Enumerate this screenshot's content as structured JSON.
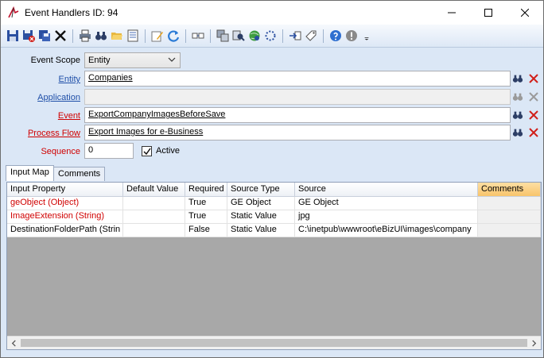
{
  "window": {
    "title": "Event Handlers ID: 94"
  },
  "toolbar": {
    "icons": [
      "save-icon",
      "save-close-icon",
      "save-all-icon",
      "delete-icon",
      "print-icon",
      "binoculars-icon",
      "open-folder-icon",
      "properties-icon",
      "edit-note-icon",
      "refresh-icon",
      "columns-icon",
      "copy-icon",
      "find-icon",
      "globe-icon",
      "settings-spin-icon",
      "import-icon",
      "tag-icon",
      "help-icon",
      "stop-info-icon",
      "overflow-icon"
    ]
  },
  "form": {
    "event_scope": {
      "label": "Event Scope",
      "value": "Entity"
    },
    "entity": {
      "label": "Entity",
      "value": "Companies"
    },
    "application": {
      "label": "Application",
      "value": ""
    },
    "event": {
      "label": "Event",
      "value": "ExportCompanyImagesBeforeSave"
    },
    "process_flow": {
      "label": "Process Flow",
      "value": "Export Images for e-Business"
    },
    "sequence": {
      "label": "Sequence",
      "value": "0"
    },
    "active": {
      "label": "Active",
      "checked": true
    }
  },
  "tabs": [
    {
      "label": "Input Map",
      "active": true
    },
    {
      "label": "Comments",
      "active": false
    }
  ],
  "grid": {
    "columns": [
      "Input Property",
      "Default Value",
      "Required",
      "Source Type",
      "Source",
      "Comments"
    ],
    "rows": [
      {
        "input_property": "geObject (Object)",
        "default_value": "",
        "required": "True",
        "source_type": "GE Object",
        "source": "GE Object",
        "comments": "",
        "required_flag": true
      },
      {
        "input_property": "ImageExtension (String)",
        "default_value": "",
        "required": "True",
        "source_type": "Static Value",
        "source": "jpg",
        "comments": "",
        "required_flag": true
      },
      {
        "input_property": "DestinationFolderPath (Strin",
        "default_value": "",
        "required": "False",
        "source_type": "Static Value",
        "source": "C:\\inetpub\\wwwroot\\eBizUI\\images\\company",
        "comments": "",
        "required_flag": false
      }
    ]
  },
  "colors": {
    "required_text": "#d00000",
    "link": "#1f4fa8",
    "window_bg": "#dbe7f6",
    "sorted_header": "#f8c46b"
  }
}
